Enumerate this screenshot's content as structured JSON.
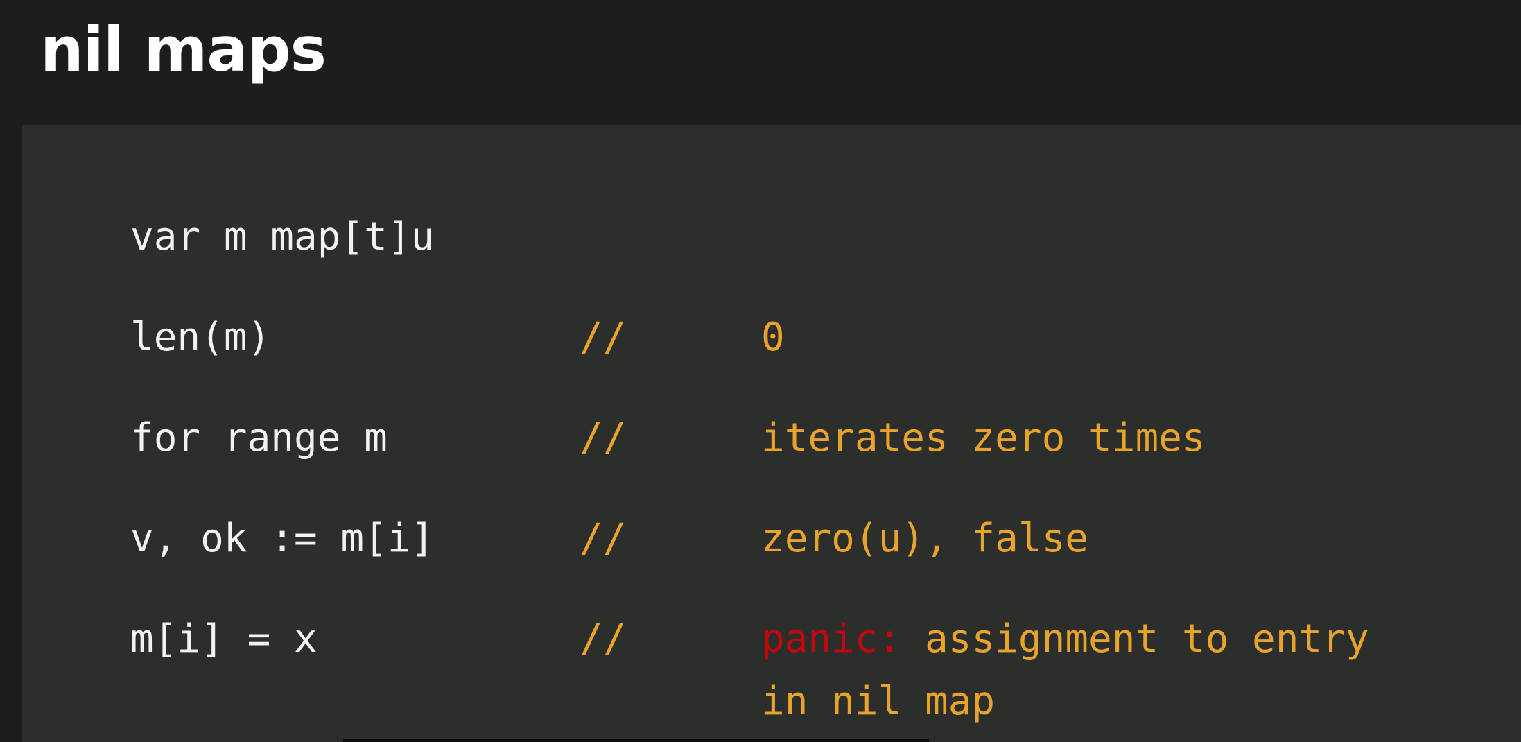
{
  "slide": {
    "title": "nil maps"
  },
  "colors": {
    "background": "#1d1e1c",
    "code_panel": "#2c2e2b",
    "code_text": "#f2f2ee",
    "comment_text": "#e8a32a",
    "panic_text": "#c4060f"
  },
  "code_lines": [
    {
      "code": "var m map[t]u",
      "slashes": "",
      "comment": ""
    },
    {
      "code": "len(m)",
      "slashes": "//",
      "comment": "0"
    },
    {
      "code": "for range m",
      "slashes": "//",
      "comment": "iterates zero times"
    },
    {
      "code": "v, ok := m[i]",
      "slashes": "//",
      "comment": "zero(u), false"
    },
    {
      "code": "m[i] = x",
      "slashes": "//",
      "panic_keyword": "panic:",
      "comment": " assignment to entry",
      "comment_continued": "in nil map"
    }
  ]
}
